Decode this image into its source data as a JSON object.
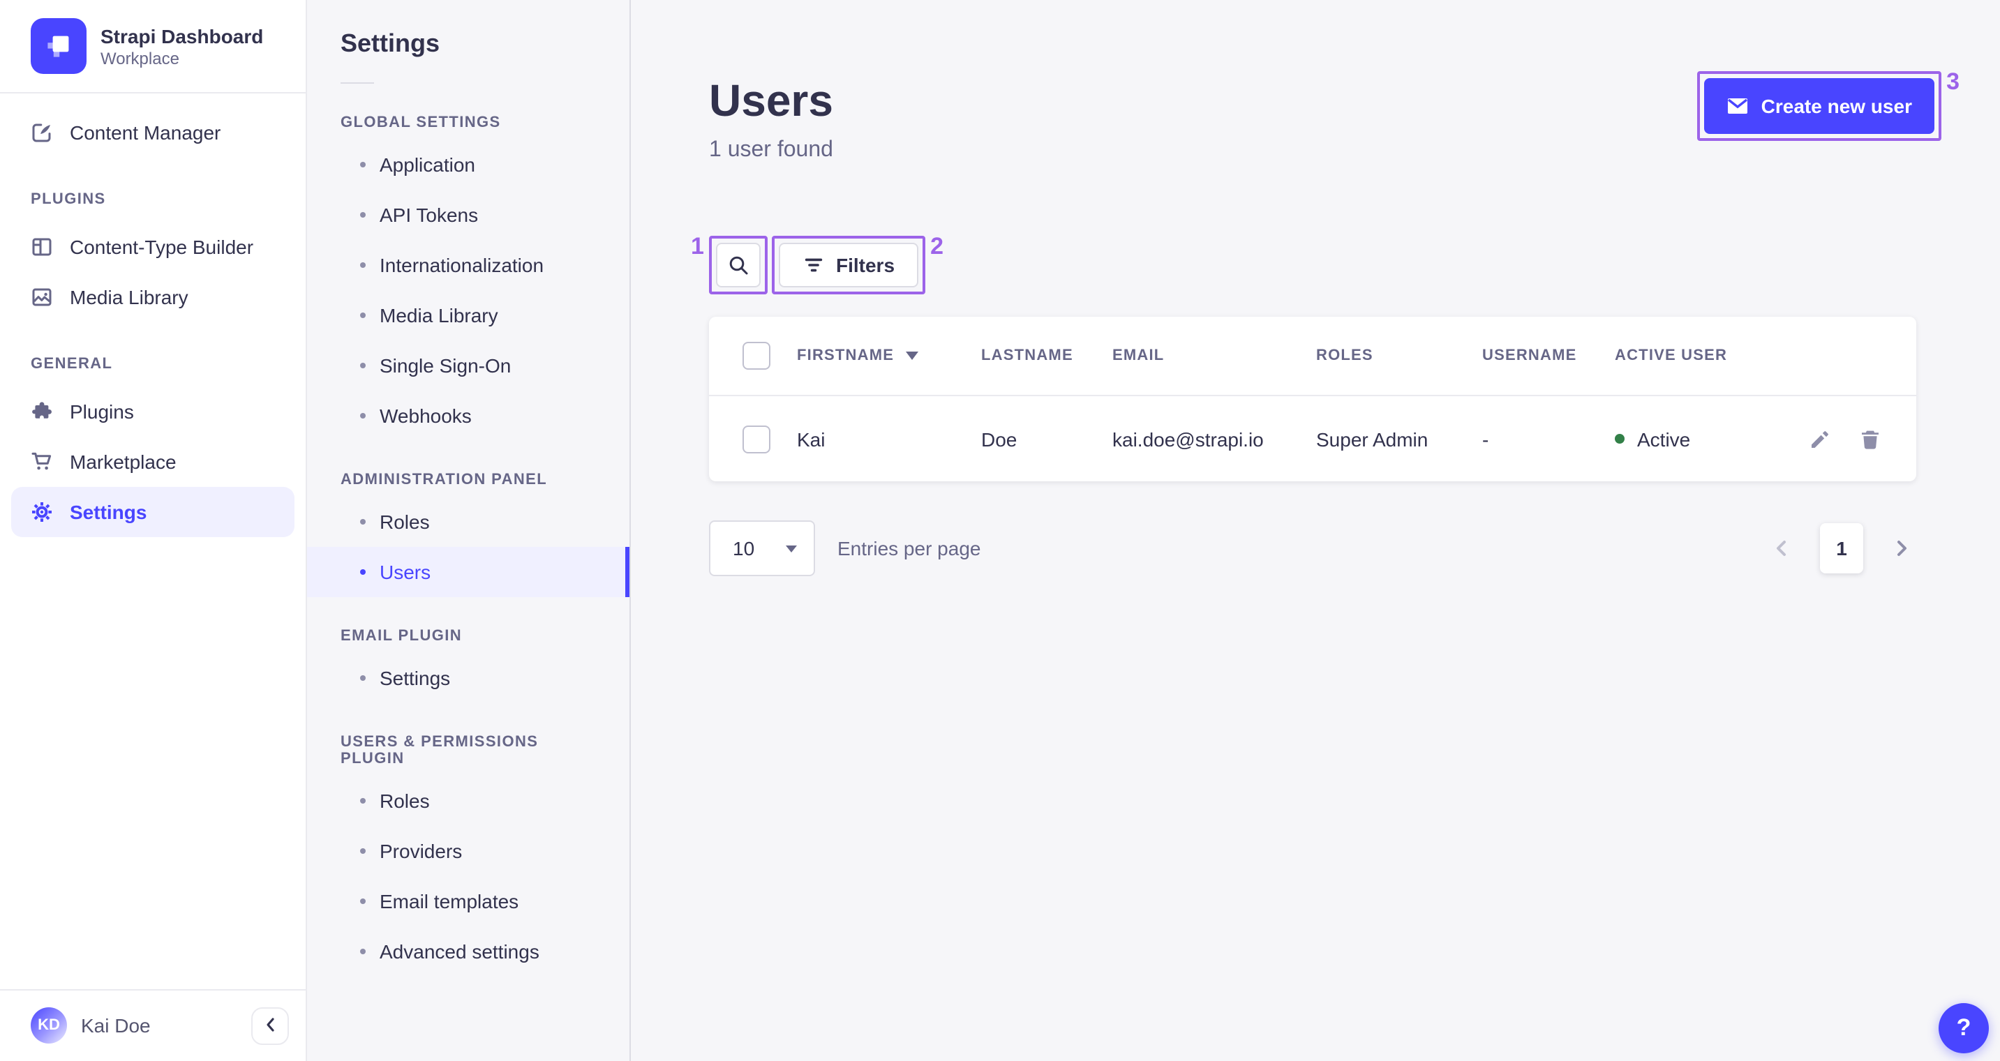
{
  "brand": {
    "name": "Strapi Dashboard",
    "workspace": "Workplace"
  },
  "sidebar": {
    "content_manager": "Content Manager",
    "sections": [
      {
        "heading": "PLUGINS",
        "items": [
          "Content-Type Builder",
          "Media Library"
        ]
      },
      {
        "heading": "GENERAL",
        "items": [
          "Plugins",
          "Marketplace",
          "Settings"
        ]
      }
    ],
    "active_item": "Settings",
    "footer": {
      "initials": "KD",
      "name": "Kai Doe"
    }
  },
  "subnav": {
    "title": "Settings",
    "groups": [
      {
        "heading": "GLOBAL SETTINGS",
        "items": [
          "Application",
          "API Tokens",
          "Internationalization",
          "Media Library",
          "Single Sign-On",
          "Webhooks"
        ]
      },
      {
        "heading": "ADMINISTRATION PANEL",
        "items": [
          "Roles",
          "Users"
        ]
      },
      {
        "heading": "EMAIL PLUGIN",
        "items": [
          "Settings"
        ]
      },
      {
        "heading": "USERS & PERMISSIONS PLUGIN",
        "items": [
          "Roles",
          "Providers",
          "Email templates",
          "Advanced settings"
        ]
      }
    ],
    "active_item": "Users"
  },
  "page": {
    "title": "Users",
    "subtitle": "1 user found",
    "create_button_label": "Create new user",
    "filters_button_label": "Filters"
  },
  "table": {
    "headers": {
      "firstname": "FIRSTNAME",
      "lastname": "LASTNAME",
      "email": "EMAIL",
      "roles": "ROLES",
      "username": "USERNAME",
      "active": "ACTIVE USER"
    },
    "rows": [
      {
        "firstname": "Kai",
        "lastname": "Doe",
        "email": "kai.doe@strapi.io",
        "roles": "Super Admin",
        "username": "-",
        "active_status": "Active"
      }
    ]
  },
  "pagination": {
    "page_size": "10",
    "entries_label": "Entries per page",
    "current_page": "1"
  },
  "annotations": {
    "marks": [
      "1",
      "2",
      "3"
    ],
    "color": "#9C63E9"
  },
  "help": {
    "label": "?"
  },
  "icons": [
    "strapi-logo-icon",
    "content-manager-icon",
    "content-type-builder-icon",
    "media-library-icon",
    "plugins-icon",
    "marketplace-icon",
    "settings-gear-icon",
    "search-icon",
    "filter-icon",
    "envelope-icon",
    "sort-desc-icon",
    "edit-pencil-icon",
    "delete-trash-icon",
    "chevron-left-icon",
    "chevron-right-icon",
    "collapse-chevron-icon",
    "status-dot-icon",
    "select-caret-icon"
  ],
  "colors": {
    "primary": "#4945FF",
    "primary_light": "#F0F0FF",
    "success": "#328048",
    "annotation": "#9C63E9"
  }
}
